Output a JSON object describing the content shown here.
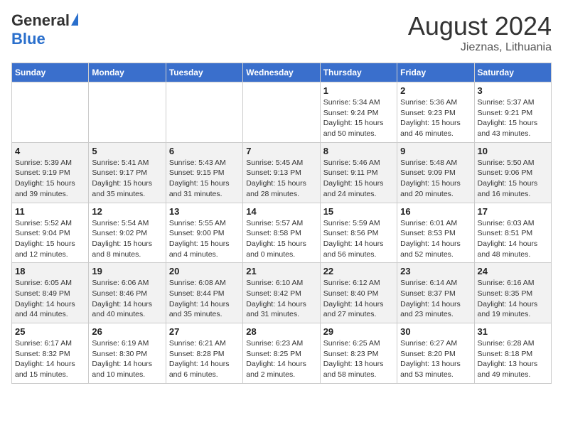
{
  "header": {
    "logo_general": "General",
    "logo_blue": "Blue",
    "month_year": "August 2024",
    "location": "Jieznas, Lithuania"
  },
  "weekdays": [
    "Sunday",
    "Monday",
    "Tuesday",
    "Wednesday",
    "Thursday",
    "Friday",
    "Saturday"
  ],
  "weeks": [
    [
      {
        "day": "",
        "info": ""
      },
      {
        "day": "",
        "info": ""
      },
      {
        "day": "",
        "info": ""
      },
      {
        "day": "",
        "info": ""
      },
      {
        "day": "1",
        "info": "Sunrise: 5:34 AM\nSunset: 9:24 PM\nDaylight: 15 hours\nand 50 minutes."
      },
      {
        "day": "2",
        "info": "Sunrise: 5:36 AM\nSunset: 9:23 PM\nDaylight: 15 hours\nand 46 minutes."
      },
      {
        "day": "3",
        "info": "Sunrise: 5:37 AM\nSunset: 9:21 PM\nDaylight: 15 hours\nand 43 minutes."
      }
    ],
    [
      {
        "day": "4",
        "info": "Sunrise: 5:39 AM\nSunset: 9:19 PM\nDaylight: 15 hours\nand 39 minutes."
      },
      {
        "day": "5",
        "info": "Sunrise: 5:41 AM\nSunset: 9:17 PM\nDaylight: 15 hours\nand 35 minutes."
      },
      {
        "day": "6",
        "info": "Sunrise: 5:43 AM\nSunset: 9:15 PM\nDaylight: 15 hours\nand 31 minutes."
      },
      {
        "day": "7",
        "info": "Sunrise: 5:45 AM\nSunset: 9:13 PM\nDaylight: 15 hours\nand 28 minutes."
      },
      {
        "day": "8",
        "info": "Sunrise: 5:46 AM\nSunset: 9:11 PM\nDaylight: 15 hours\nand 24 minutes."
      },
      {
        "day": "9",
        "info": "Sunrise: 5:48 AM\nSunset: 9:09 PM\nDaylight: 15 hours\nand 20 minutes."
      },
      {
        "day": "10",
        "info": "Sunrise: 5:50 AM\nSunset: 9:06 PM\nDaylight: 15 hours\nand 16 minutes."
      }
    ],
    [
      {
        "day": "11",
        "info": "Sunrise: 5:52 AM\nSunset: 9:04 PM\nDaylight: 15 hours\nand 12 minutes."
      },
      {
        "day": "12",
        "info": "Sunrise: 5:54 AM\nSunset: 9:02 PM\nDaylight: 15 hours\nand 8 minutes."
      },
      {
        "day": "13",
        "info": "Sunrise: 5:55 AM\nSunset: 9:00 PM\nDaylight: 15 hours\nand 4 minutes."
      },
      {
        "day": "14",
        "info": "Sunrise: 5:57 AM\nSunset: 8:58 PM\nDaylight: 15 hours\nand 0 minutes."
      },
      {
        "day": "15",
        "info": "Sunrise: 5:59 AM\nSunset: 8:56 PM\nDaylight: 14 hours\nand 56 minutes."
      },
      {
        "day": "16",
        "info": "Sunrise: 6:01 AM\nSunset: 8:53 PM\nDaylight: 14 hours\nand 52 minutes."
      },
      {
        "day": "17",
        "info": "Sunrise: 6:03 AM\nSunset: 8:51 PM\nDaylight: 14 hours\nand 48 minutes."
      }
    ],
    [
      {
        "day": "18",
        "info": "Sunrise: 6:05 AM\nSunset: 8:49 PM\nDaylight: 14 hours\nand 44 minutes."
      },
      {
        "day": "19",
        "info": "Sunrise: 6:06 AM\nSunset: 8:46 PM\nDaylight: 14 hours\nand 40 minutes."
      },
      {
        "day": "20",
        "info": "Sunrise: 6:08 AM\nSunset: 8:44 PM\nDaylight: 14 hours\nand 35 minutes."
      },
      {
        "day": "21",
        "info": "Sunrise: 6:10 AM\nSunset: 8:42 PM\nDaylight: 14 hours\nand 31 minutes."
      },
      {
        "day": "22",
        "info": "Sunrise: 6:12 AM\nSunset: 8:40 PM\nDaylight: 14 hours\nand 27 minutes."
      },
      {
        "day": "23",
        "info": "Sunrise: 6:14 AM\nSunset: 8:37 PM\nDaylight: 14 hours\nand 23 minutes."
      },
      {
        "day": "24",
        "info": "Sunrise: 6:16 AM\nSunset: 8:35 PM\nDaylight: 14 hours\nand 19 minutes."
      }
    ],
    [
      {
        "day": "25",
        "info": "Sunrise: 6:17 AM\nSunset: 8:32 PM\nDaylight: 14 hours\nand 15 minutes."
      },
      {
        "day": "26",
        "info": "Sunrise: 6:19 AM\nSunset: 8:30 PM\nDaylight: 14 hours\nand 10 minutes."
      },
      {
        "day": "27",
        "info": "Sunrise: 6:21 AM\nSunset: 8:28 PM\nDaylight: 14 hours\nand 6 minutes."
      },
      {
        "day": "28",
        "info": "Sunrise: 6:23 AM\nSunset: 8:25 PM\nDaylight: 14 hours\nand 2 minutes."
      },
      {
        "day": "29",
        "info": "Sunrise: 6:25 AM\nSunset: 8:23 PM\nDaylight: 13 hours\nand 58 minutes."
      },
      {
        "day": "30",
        "info": "Sunrise: 6:27 AM\nSunset: 8:20 PM\nDaylight: 13 hours\nand 53 minutes."
      },
      {
        "day": "31",
        "info": "Sunrise: 6:28 AM\nSunset: 8:18 PM\nDaylight: 13 hours\nand 49 minutes."
      }
    ]
  ]
}
